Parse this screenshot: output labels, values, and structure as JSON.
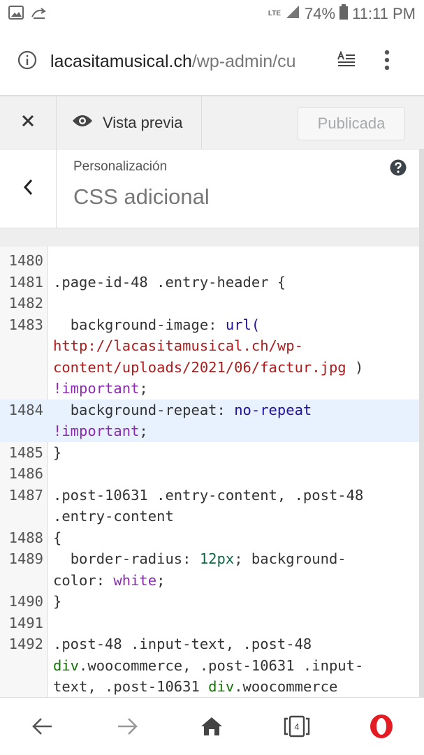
{
  "status_bar": {
    "network_type": "LTE",
    "battery": "74%",
    "time": "11:11 PM"
  },
  "browser": {
    "url_domain": "lacasitamusical.ch",
    "url_path": "/wp-admin/cu",
    "tab_count": "4"
  },
  "customizer": {
    "close_label": "×",
    "preview_label": "Vista previa",
    "publish_label": "Publicada",
    "breadcrumb": "Personalización",
    "section_title": "CSS adicional"
  },
  "editor": {
    "lines": [
      {
        "n": "1480"
      },
      {
        "n": "1481"
      },
      {
        "n": "1482"
      },
      {
        "n": "1483"
      },
      {
        "n": ""
      },
      {
        "n": ""
      },
      {
        "n": ""
      },
      {
        "n": "1484"
      },
      {
        "n": ""
      },
      {
        "n": "1485"
      },
      {
        "n": "1486"
      },
      {
        "n": "1487"
      },
      {
        "n": ""
      },
      {
        "n": "1488"
      },
      {
        "n": "1489"
      },
      {
        "n": ""
      },
      {
        "n": "1490"
      },
      {
        "n": "1491"
      },
      {
        "n": "1492"
      },
      {
        "n": ""
      },
      {
        "n": ""
      }
    ],
    "code": {
      "l1481": ".page-id-48 .entry-header {",
      "l1483_prop": "  background-image: ",
      "l1483_fn": "url(",
      "l1483_url1": "http://lacasitamusical.ch/wp-",
      "l1483_url2": "content/uploads/2021/06/factur.jpg",
      "l1483_close": " )",
      "l1483_imp": "!important",
      "semi": ";",
      "l1484_prop": "  background-repeat: ",
      "l1484_val": "no-repeat",
      "l1484_imp": "!important",
      "l1485": "}",
      "l1487a": ".post-10631 .entry-content, .post-48",
      "l1487b": ".entry-content",
      "l1488": "{",
      "l1489_prop": "  border-radius: ",
      "l1489_num": "12px",
      "l1489_mid": "; background-",
      "l1489_prop2": "color: ",
      "l1489_val": "white",
      "l1490": "}",
      "l1492a": ".post-48 .input-text, .post-48",
      "l1492b_tag": "div",
      "l1492b_rest": ".woocommerce, .post-10631 .input-",
      "l1492c_a": "text, .post-10631 ",
      "l1492c_tag": "div",
      "l1492c_rest": ".woocommerce"
    }
  },
  "colors": {
    "highlight": "#e8f2ff",
    "keyword": "#8a2bb0",
    "url": "#aa1d1d",
    "opera_red": "#e31b23"
  },
  "icons": [
    "image-icon",
    "sync-icon",
    "signal-icon",
    "battery-icon",
    "info-icon",
    "reader-mode-icon",
    "menu-dots-icon",
    "close-icon",
    "eye-icon",
    "chevron-left-icon",
    "help-icon",
    "back-arrow-icon",
    "forward-arrow-icon",
    "home-icon",
    "tabs-icon",
    "opera-icon"
  ]
}
